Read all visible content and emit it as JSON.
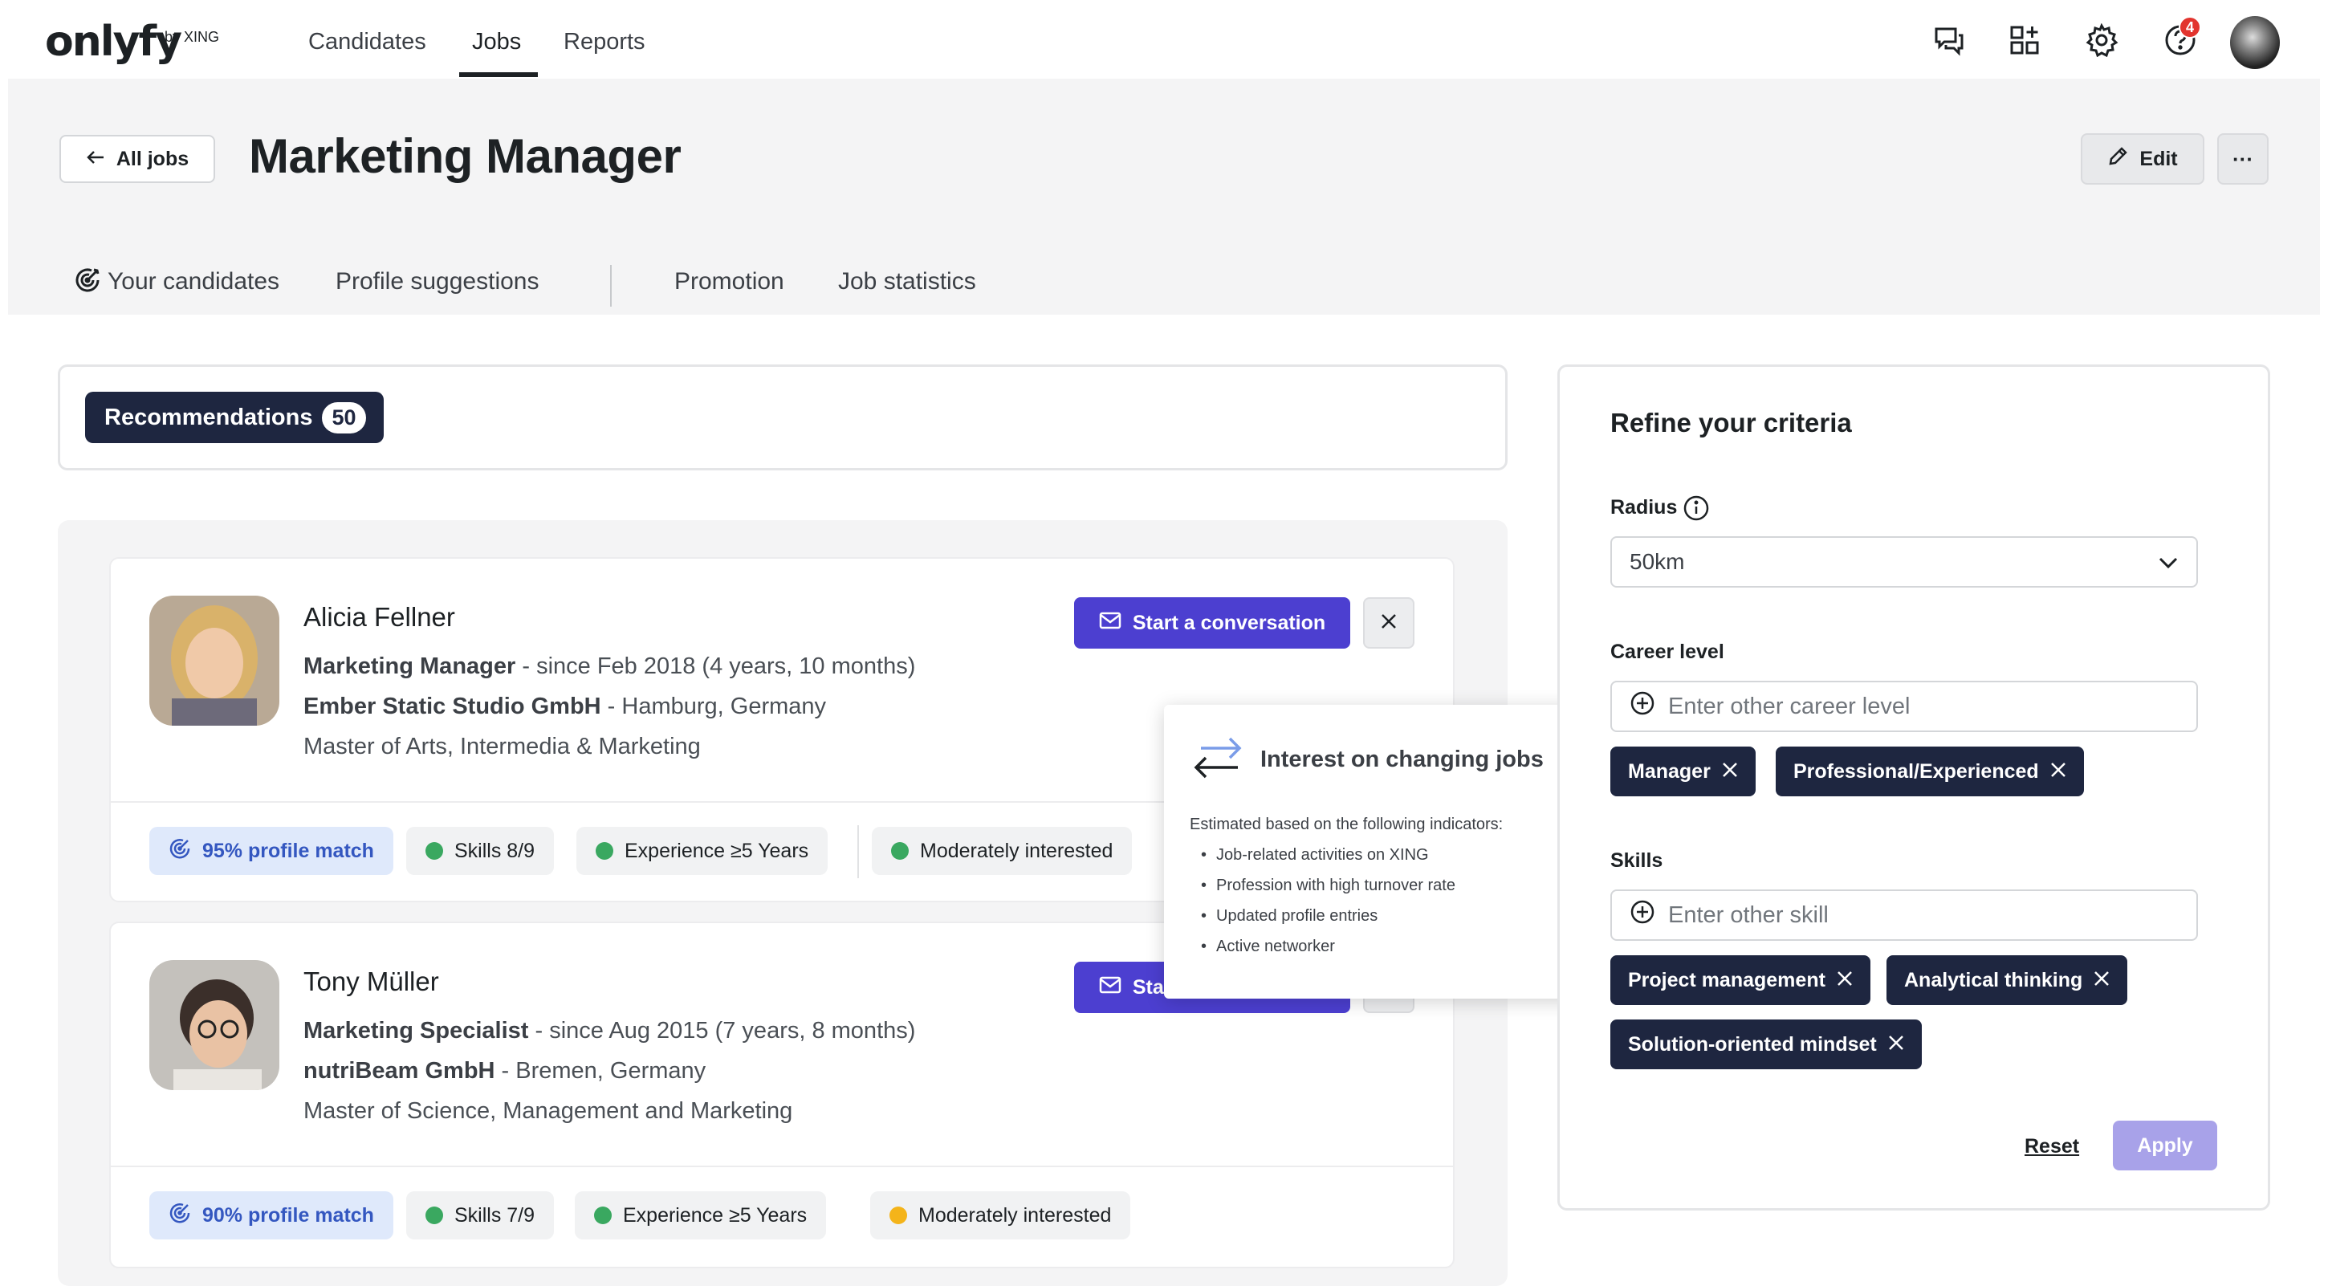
{
  "app": {
    "logo_text": "onlyfy",
    "logo_by": "by XING"
  },
  "nav": {
    "items": [
      {
        "label": "Candidates"
      },
      {
        "label": "Jobs"
      },
      {
        "label": "Reports"
      }
    ],
    "active": "Jobs",
    "notification_count": "4"
  },
  "header": {
    "back_label": "All jobs",
    "title": "Marketing Manager",
    "edit_label": "Edit",
    "more_label": "···"
  },
  "tabs": [
    {
      "label": "Your candidates"
    },
    {
      "label": "Profile suggestions"
    },
    {
      "label": "Promotion"
    },
    {
      "label": "Job statistics"
    }
  ],
  "recommendations": {
    "label": "Recommendations",
    "count": "50"
  },
  "candidates": [
    {
      "name": "Alicia Fellner",
      "role": "Marketing Manager",
      "role_detail": " - since Feb 2018 (4 years, 10 months)",
      "company": "Ember Static Studio GmbH",
      "company_detail": " - Hamburg, Germany",
      "education": "Master of Arts, Intermedia & Marketing",
      "action_label": "Start a conversation",
      "match": "95% profile match",
      "skills": "Skills 8/9",
      "experience": "Experience  ≥5 Years",
      "interest": "Moderately interested"
    },
    {
      "name": "Tony Müller",
      "role": "Marketing Specialist",
      "role_detail": " - since Aug 2015 (7 years, 8 months)",
      "company": "nutriBeam GmbH",
      "company_detail": " - Bremen, Germany",
      "education": "Master of Science, Management and Marketing",
      "action_label": "Start a conversation",
      "match": "90% profile match",
      "skills": "Skills 7/9",
      "experience": "Experience  ≥5 Years",
      "interest": "Moderately interested"
    }
  ],
  "tooltip": {
    "title": "Interest on changing jobs",
    "subtitle": "Estimated based on the following indicators:",
    "items": [
      "Job-related activities on XING",
      "Profession with high turnover rate",
      "Updated profile entries",
      "Active networker"
    ]
  },
  "refine": {
    "title": "Refine your criteria",
    "radius_label": "Radius",
    "radius_value": "50km",
    "career_label": "Career level",
    "career_placeholder": "Enter other career level",
    "career_tags": [
      "Manager",
      "Professional/Experienced"
    ],
    "skills_label": "Skills",
    "skills_placeholder": "Enter other skill",
    "skill_tags": [
      "Project management",
      "Analytical thinking",
      "Solution-oriented mindset"
    ],
    "reset_label": "Reset",
    "apply_label": "Apply"
  },
  "colors": {
    "primary": "#4c3fd0",
    "dark_navy": "#1e2640",
    "match_bg": "#dfe9fb",
    "status_green": "#3aa860",
    "status_yellow": "#f4b41a",
    "notification_red": "#e2342e"
  },
  "icons": {
    "nav": [
      "chat-icon",
      "apps-grid-icon",
      "gear-icon",
      "help-icon"
    ],
    "filters": [
      "info-icon",
      "chevron-down-icon",
      "plus-circle-icon",
      "close-icon"
    ]
  }
}
